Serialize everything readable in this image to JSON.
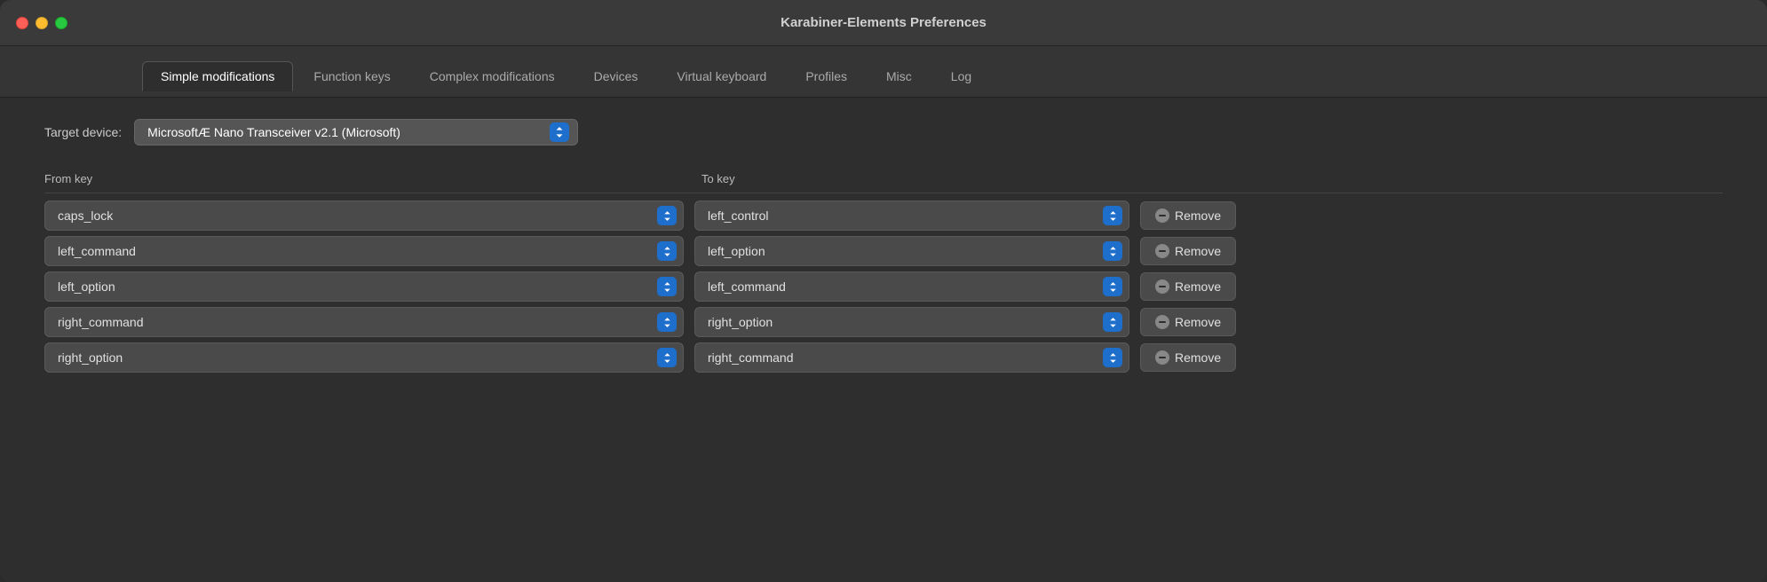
{
  "window": {
    "title": "Karabiner-Elements Preferences"
  },
  "tabs": [
    {
      "id": "simple-modifications",
      "label": "Simple modifications",
      "active": true
    },
    {
      "id": "function-keys",
      "label": "Function keys",
      "active": false
    },
    {
      "id": "complex-modifications",
      "label": "Complex modifications",
      "active": false
    },
    {
      "id": "devices",
      "label": "Devices",
      "active": false
    },
    {
      "id": "virtual-keyboard",
      "label": "Virtual keyboard",
      "active": false
    },
    {
      "id": "profiles",
      "label": "Profiles",
      "active": false
    },
    {
      "id": "misc",
      "label": "Misc",
      "active": false
    },
    {
      "id": "log",
      "label": "Log",
      "active": false
    }
  ],
  "target_device": {
    "label": "Target device:",
    "selected": "MicrosoftÆ Nano Transceiver v2.1 (Microsoft)"
  },
  "table": {
    "from_header": "From key",
    "to_header": "To key",
    "rows": [
      {
        "from": "caps_lock",
        "to": "left_control"
      },
      {
        "from": "left_command",
        "to": "left_option"
      },
      {
        "from": "left_option",
        "to": "left_command"
      },
      {
        "from": "right_command",
        "to": "right_option"
      },
      {
        "from": "right_option",
        "to": "right_command"
      }
    ],
    "remove_label": "Remove"
  }
}
